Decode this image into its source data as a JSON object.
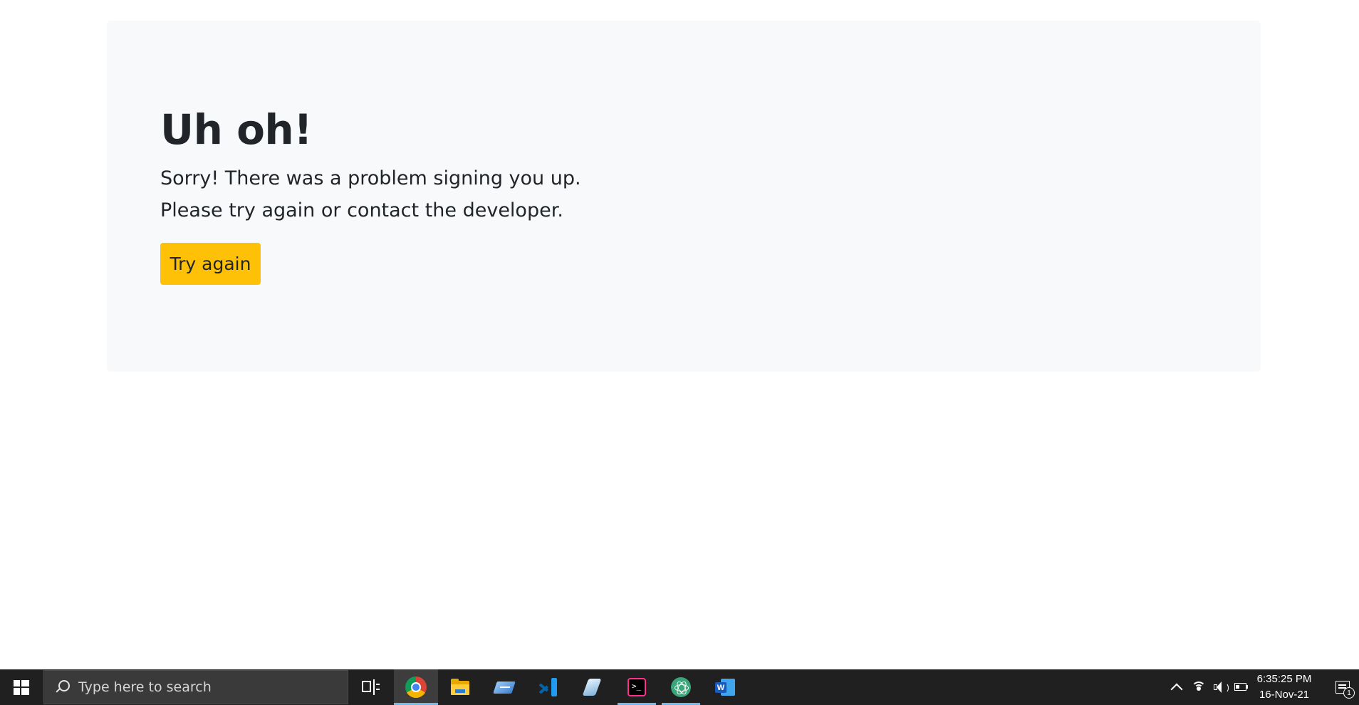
{
  "page": {
    "heading": "Uh oh!",
    "message_line1": "Sorry! There was a problem signing you up.",
    "message_line2": "Please try again or contact the developer.",
    "retry_button_label": "Try again",
    "button_color": "#ffc107",
    "panel_background": "#f8f9fa"
  },
  "taskbar": {
    "search_placeholder": "Type here to search",
    "apps": [
      {
        "name": "task-view",
        "icon": "task-view-icon",
        "active": false
      },
      {
        "name": "chrome",
        "icon": "chrome-icon",
        "active": true
      },
      {
        "name": "file-explorer",
        "icon": "folder-icon",
        "active": false
      },
      {
        "name": "azure-data-studio",
        "icon": "azure-icon",
        "active": false
      },
      {
        "name": "vscode",
        "icon": "vscode-icon",
        "active": false
      },
      {
        "name": "feather-app",
        "icon": "feather-icon",
        "active": false
      },
      {
        "name": "terminal",
        "icon": "terminal-icon",
        "active": false,
        "running": true
      },
      {
        "name": "electron-app",
        "icon": "electron-icon",
        "active": false,
        "running": true
      },
      {
        "name": "word",
        "icon": "word-icon",
        "active": false
      }
    ],
    "clock_time": "6:35:25 PM",
    "clock_date": "16-Nov-21",
    "notification_count": "1"
  }
}
